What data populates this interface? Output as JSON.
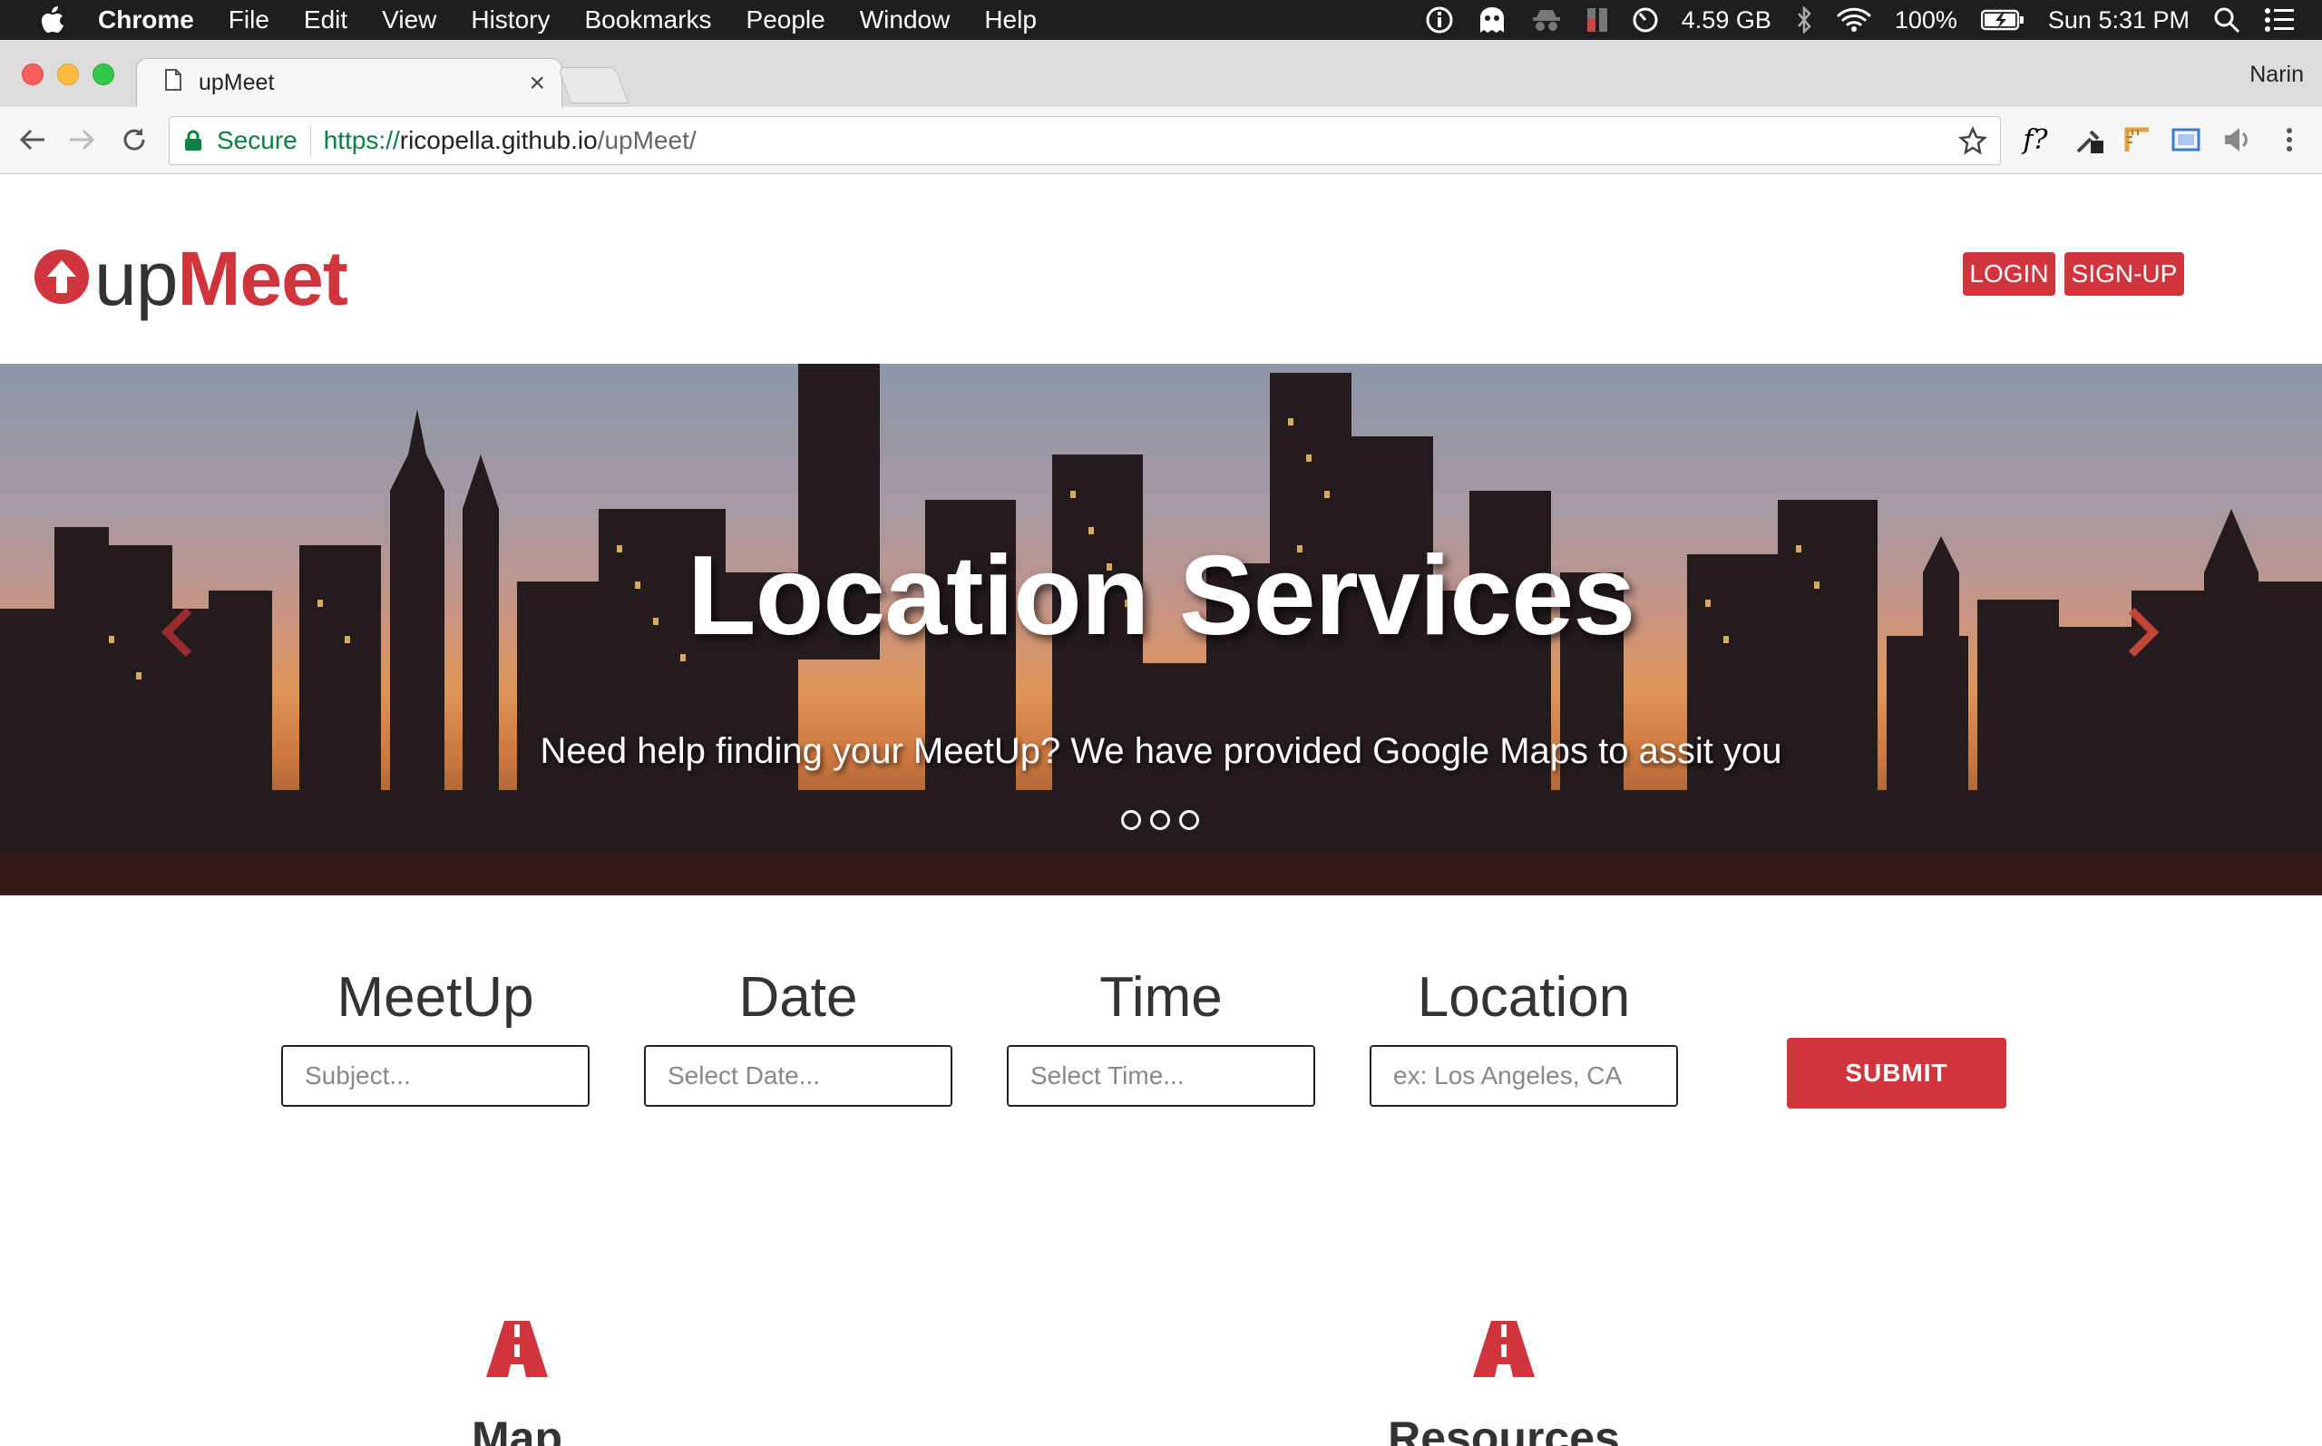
{
  "menubar": {
    "app_name": "Chrome",
    "items": [
      "File",
      "Edit",
      "View",
      "History",
      "Bookmarks",
      "People",
      "Window",
      "Help"
    ],
    "memory": "4.59 GB",
    "battery": "100%",
    "clock": "Sun 5:31 PM"
  },
  "browser": {
    "tab_title": "upMeet",
    "profile_name": "Narin",
    "security_label": "Secure",
    "url_scheme": "https://",
    "url_host": "ricopella.github.io",
    "url_path": "/upMeet/",
    "extension_fx_label": "f?"
  },
  "header": {
    "logo_up": "up",
    "logo_meet": "Meet",
    "login_label": "LOGIN",
    "signup_label": "SIGN-UP"
  },
  "hero": {
    "title": "Location Services",
    "subtitle": "Need help finding your MeetUp? We have provided Google Maps to assit you",
    "slide_count": 3
  },
  "search_form": {
    "fields": [
      {
        "label": "MeetUp",
        "placeholder": "Subject..."
      },
      {
        "label": "Date",
        "placeholder": "Select Date..."
      },
      {
        "label": "Time",
        "placeholder": "Select Time..."
      },
      {
        "label": "Location",
        "placeholder": "ex: Los Angeles, CA"
      }
    ],
    "submit_label": "SUBMIT"
  },
  "features": [
    {
      "title": "Map",
      "icon": "road-icon"
    },
    {
      "title": "Resources",
      "icon": "road-icon"
    }
  ],
  "colors": {
    "brand_red": "#d0343c",
    "menubar_bg": "#1e1e1e",
    "secure_green": "#0b8043"
  }
}
